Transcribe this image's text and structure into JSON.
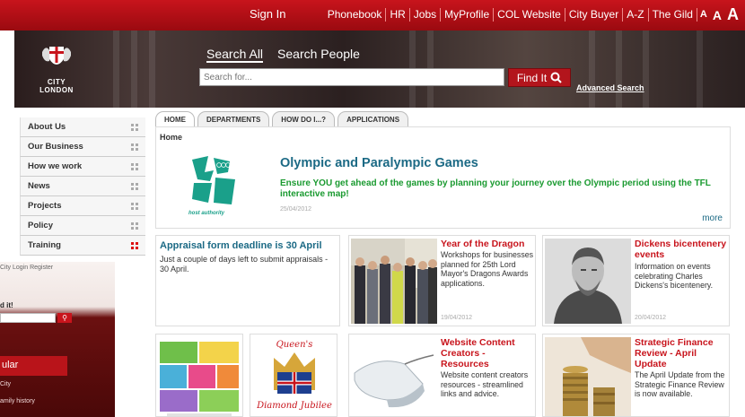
{
  "topbar": {
    "signin": "Sign In",
    "links": [
      "Phonebook",
      "HR",
      "Jobs",
      "MyProfile",
      "COL Website",
      "City Buyer",
      "A-Z",
      "The Gild"
    ],
    "text_sizes": [
      "A",
      "A",
      "A"
    ]
  },
  "header": {
    "logo_text": [
      "CITY",
      "LONDON"
    ],
    "search_tabs": [
      "Search All",
      "Search People"
    ],
    "search_placeholder": "Search for...",
    "find_button": "Find It",
    "advanced_search": "Advanced Search"
  },
  "sidebar": {
    "items": [
      "About Us",
      "Our Business",
      "How we work",
      "News",
      "Projects",
      "Policy",
      "Training"
    ]
  },
  "behind_window": {
    "logreg": "City Login Register",
    "find_label": "d it!",
    "popular": "ular",
    "item1": "City",
    "item2": "amily history"
  },
  "tabs": [
    "HOME",
    "DEPARTMENTS",
    "HOW DO I...?",
    "APPLICATIONS"
  ],
  "main": {
    "breadcrumb": "Home",
    "headline": "Olympic and Paralympic Games",
    "description": "Ensure YOU get ahead of the games by planning your journey over the Olympic period using the TFL interactive map!",
    "date": "25/04/2012",
    "more": "more",
    "logo_caption": "host authority"
  },
  "cards": {
    "appraisal": {
      "title": "Appraisal form deadline is 30 April",
      "desc": "Just a couple of days left to submit appraisals - 30 April."
    },
    "dragon": {
      "title": "Year of the Dragon",
      "desc": "Workshops for businesses planned for 25th Lord Mayor's Dragons Awards applications.",
      "date": "19/04/2012"
    },
    "dickens": {
      "title": "Dickens bicentenery events",
      "desc": "Information on events celebrating Charles Dickens's bicentenery.",
      "date": "20/04/2012"
    },
    "website": {
      "title": "Website Content Creators - Resources",
      "desc": "Website content creators resources - streamlined links and advice."
    },
    "finance": {
      "title": "Strategic Finance Review - April Update",
      "desc": "The April Update from the Strategic Finance Review is now available."
    },
    "jubilee": {
      "caption1": "Queen's",
      "caption2": "Diamond Jubilee"
    }
  },
  "colors": {
    "brand_red": "#c8141c",
    "link_blue": "#1c6a85",
    "green": "#1a9a30"
  }
}
